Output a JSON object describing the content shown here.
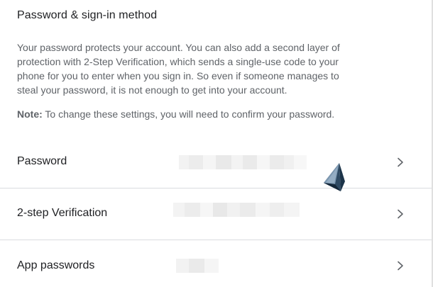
{
  "section": {
    "title": "Password & sign-in method",
    "description": "Your password protects your account. You can also add a second layer of protection with 2-Step Verification, which sends a single-use code to your phone for you to enter when you sign in. So even if someone manages to steal your password, it is not enough to get into your account.",
    "note_label": "Note:",
    "note_text": " To change these settings, you will need to confirm your password."
  },
  "rows": [
    {
      "label": "Password"
    },
    {
      "label": "2-step Verification"
    },
    {
      "label": "App passwords"
    }
  ],
  "icons": {
    "chevron": "chevron-right-icon",
    "cursor": "mouse-pointer-icon"
  },
  "colors": {
    "title": "#202124",
    "body_text": "#5f6368",
    "divider": "#dadce0",
    "chevron": "#5f6368"
  }
}
